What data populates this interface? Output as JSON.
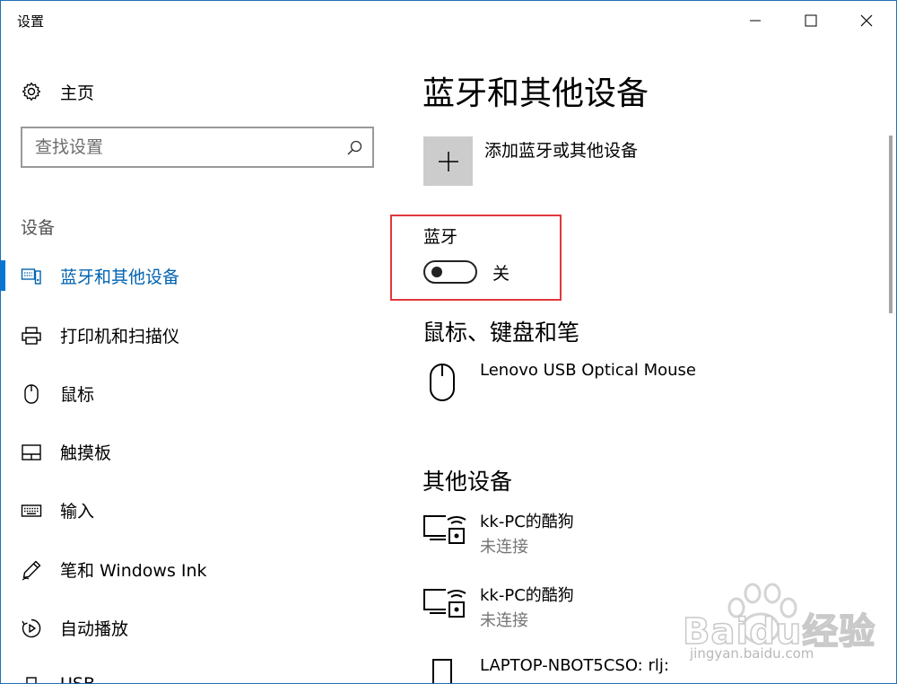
{
  "window": {
    "title": "设置",
    "controls": {
      "minimize": "minimize-icon",
      "maximize": "maximize-icon",
      "close": "close-icon"
    }
  },
  "sidebar": {
    "home_label": "主页",
    "search_placeholder": "查找设置",
    "section_title": "设备",
    "items": [
      {
        "label": "蓝牙和其他设备",
        "icon": "bluetooth-devices-icon",
        "active": true
      },
      {
        "label": "打印机和扫描仪",
        "icon": "printer-icon",
        "active": false
      },
      {
        "label": "鼠标",
        "icon": "mouse-icon",
        "active": false
      },
      {
        "label": "触摸板",
        "icon": "touchpad-icon",
        "active": false
      },
      {
        "label": "输入",
        "icon": "keyboard-icon",
        "active": false
      },
      {
        "label": "笔和 Windows Ink",
        "icon": "pen-icon",
        "active": false
      },
      {
        "label": "自动播放",
        "icon": "autoplay-icon",
        "active": false
      },
      {
        "label": "USB",
        "icon": "usb-icon",
        "active": false
      }
    ]
  },
  "content": {
    "page_title": "蓝牙和其他设备",
    "add_device_label": "添加蓝牙或其他设备",
    "bluetooth": {
      "label": "蓝牙",
      "state": "关",
      "on": false
    },
    "mouse_section": {
      "title": "鼠标、键盘和笔",
      "devices": [
        {
          "name": "Lenovo USB Optical Mouse",
          "icon": "mouse-device-icon"
        }
      ]
    },
    "other_section": {
      "title": "其他设备",
      "devices": [
        {
          "name": "kk-PC的酷狗",
          "status": "未连接",
          "icon": "media-device-icon"
        },
        {
          "name": "kk-PC的酷狗",
          "status": "未连接",
          "icon": "media-device-icon"
        },
        {
          "name": "LAPTOP-NBOT5CSO: rlj:",
          "icon": "phone-device-icon"
        }
      ]
    }
  },
  "watermark": {
    "logo": "Baidu经验",
    "url": "jingyan.baidu.com"
  },
  "colors": {
    "accent": "#0078d7",
    "highlight_box": "#e0383e",
    "tile": "#cccccc"
  }
}
